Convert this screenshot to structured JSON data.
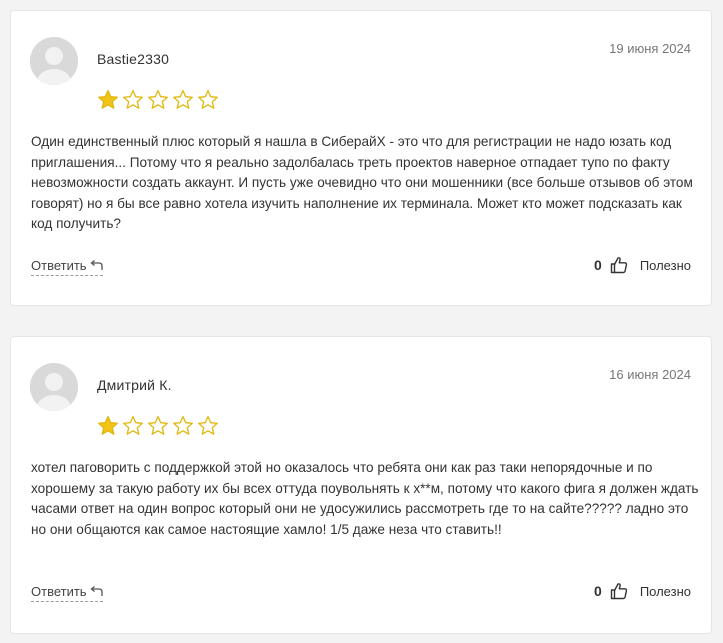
{
  "reviews": [
    {
      "author": "Bastie2330",
      "date": "19 июня 2024",
      "rating": 1,
      "max_rating": 5,
      "text": "Один единственный плюс который я нашла в СиберайХ - это что для регистрации не надо юзать код приглашения... Потому что я реально задолбалась треть проектов наверное отпадает тупо по факту невозможности создать аккаунт. И пусть уже очевидно что они мошенники (все больше отзывов об этом говорят) но я бы все равно хотела изучить наполнение их терминала. Может кто может подсказать как код получить?",
      "reply_label": "Ответить",
      "helpful_count": "0",
      "helpful_label": "Полезно"
    },
    {
      "author": "Дмитрий К.",
      "date": "16 июня 2024",
      "rating": 1,
      "max_rating": 5,
      "text": "хотел паговорить с поддержкой этой но оказалось что ребята они как раз таки непорядочные и по хорошему за такую работу их бы всех оттуда поувольнять к х**м, потому что какого фига я должен ждать часами ответ на один вопрос который они не удосужились рассмотреть где то на сайте????? ладно это но они общаются как самое настоящие хамло! 1/5 даже неза что ставить!!",
      "reply_label": "Ответить",
      "helpful_count": "0",
      "helpful_label": "Полезно"
    }
  ],
  "colors": {
    "star_fill": "#f2c417",
    "star_outline": "#e0b80f",
    "avatar_bg": "#d9d9d9",
    "card_bg": "#ffffff",
    "page_bg": "#f3f3f3"
  },
  "icons": {
    "avatar": "user-avatar-icon",
    "star": "star-icon",
    "reply": "reply-arrow-icon",
    "helpful": "thumbs-up-icon"
  }
}
